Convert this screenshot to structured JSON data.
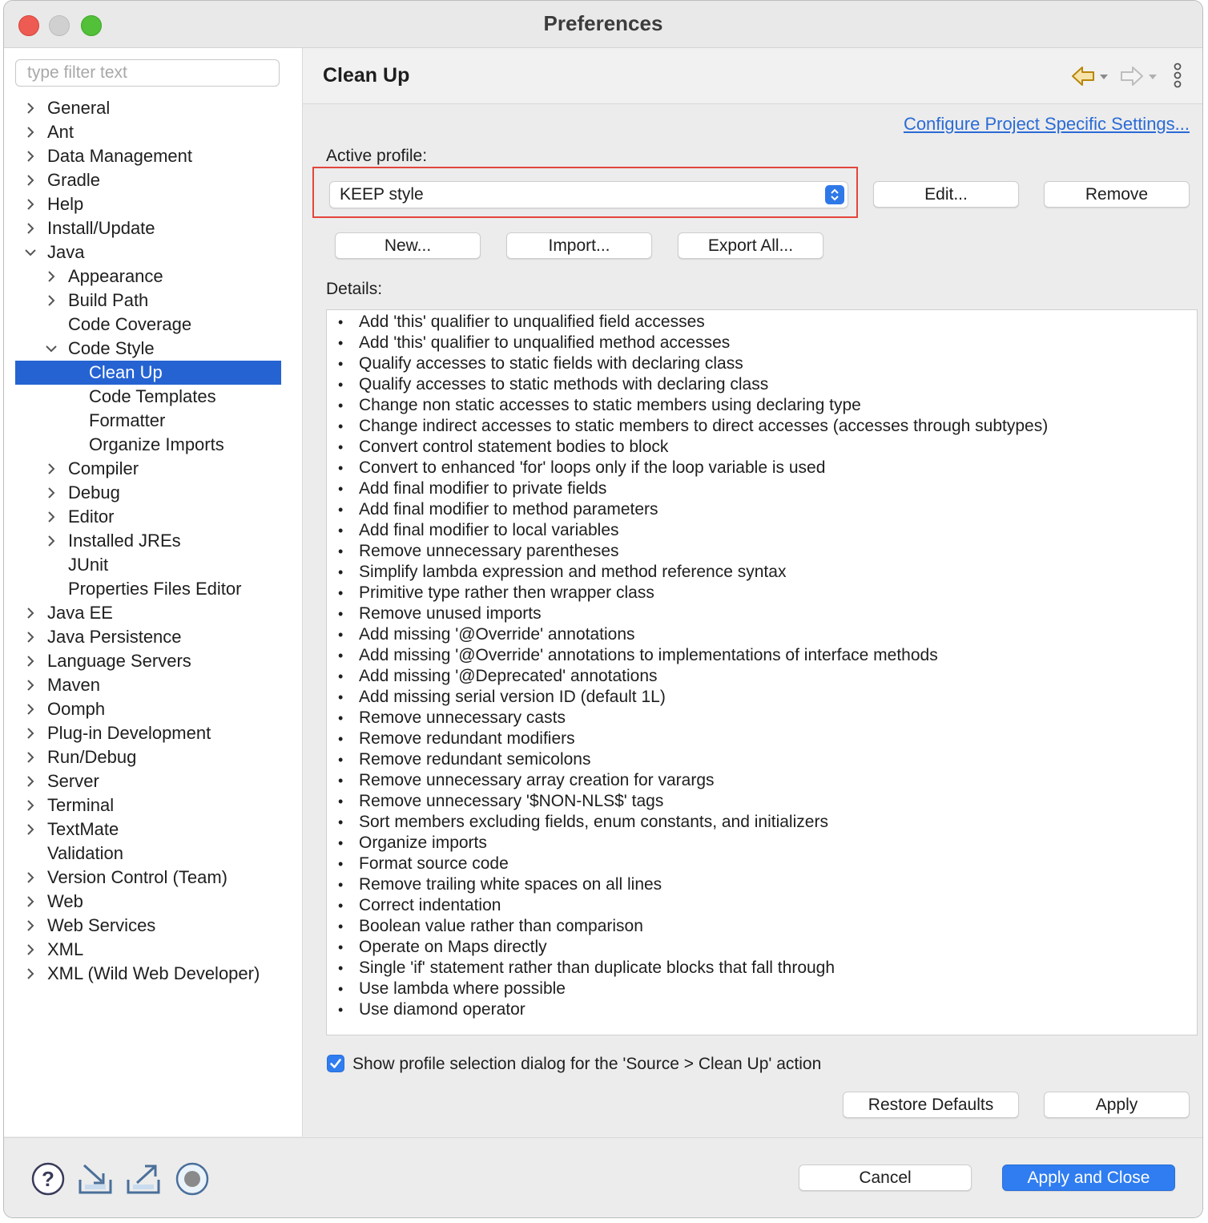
{
  "window": {
    "title": "Preferences"
  },
  "sidebar": {
    "filter_placeholder": "type filter text",
    "items": [
      {
        "label": "General",
        "level": 0,
        "expander": "collapsed"
      },
      {
        "label": "Ant",
        "level": 0,
        "expander": "collapsed"
      },
      {
        "label": "Data Management",
        "level": 0,
        "expander": "collapsed"
      },
      {
        "label": "Gradle",
        "level": 0,
        "expander": "collapsed"
      },
      {
        "label": "Help",
        "level": 0,
        "expander": "collapsed"
      },
      {
        "label": "Install/Update",
        "level": 0,
        "expander": "collapsed"
      },
      {
        "label": "Java",
        "level": 0,
        "expander": "expanded"
      },
      {
        "label": "Appearance",
        "level": 1,
        "expander": "collapsed"
      },
      {
        "label": "Build Path",
        "level": 1,
        "expander": "collapsed"
      },
      {
        "label": "Code Coverage",
        "level": 1,
        "expander": "none"
      },
      {
        "label": "Code Style",
        "level": 1,
        "expander": "expanded"
      },
      {
        "label": "Clean Up",
        "level": 2,
        "expander": "none",
        "selected": true
      },
      {
        "label": "Code Templates",
        "level": 2,
        "expander": "none"
      },
      {
        "label": "Formatter",
        "level": 2,
        "expander": "none"
      },
      {
        "label": "Organize Imports",
        "level": 2,
        "expander": "none"
      },
      {
        "label": "Compiler",
        "level": 1,
        "expander": "collapsed"
      },
      {
        "label": "Debug",
        "level": 1,
        "expander": "collapsed"
      },
      {
        "label": "Editor",
        "level": 1,
        "expander": "collapsed"
      },
      {
        "label": "Installed JREs",
        "level": 1,
        "expander": "collapsed"
      },
      {
        "label": "JUnit",
        "level": 1,
        "expander": "none"
      },
      {
        "label": "Properties Files Editor",
        "level": 1,
        "expander": "none"
      },
      {
        "label": "Java EE",
        "level": 0,
        "expander": "collapsed"
      },
      {
        "label": "Java Persistence",
        "level": 0,
        "expander": "collapsed"
      },
      {
        "label": "Language Servers",
        "level": 0,
        "expander": "collapsed"
      },
      {
        "label": "Maven",
        "level": 0,
        "expander": "collapsed"
      },
      {
        "label": "Oomph",
        "level": 0,
        "expander": "collapsed"
      },
      {
        "label": "Plug-in Development",
        "level": 0,
        "expander": "collapsed"
      },
      {
        "label": "Run/Debug",
        "level": 0,
        "expander": "collapsed"
      },
      {
        "label": "Server",
        "level": 0,
        "expander": "collapsed"
      },
      {
        "label": "Terminal",
        "level": 0,
        "expander": "collapsed"
      },
      {
        "label": "TextMate",
        "level": 0,
        "expander": "collapsed"
      },
      {
        "label": "Validation",
        "level": 0,
        "expander": "none"
      },
      {
        "label": "Version Control (Team)",
        "level": 0,
        "expander": "collapsed"
      },
      {
        "label": "Web",
        "level": 0,
        "expander": "collapsed"
      },
      {
        "label": "Web Services",
        "level": 0,
        "expander": "collapsed"
      },
      {
        "label": "XML",
        "level": 0,
        "expander": "collapsed"
      },
      {
        "label": "XML (Wild Web Developer)",
        "level": 0,
        "expander": "collapsed"
      }
    ]
  },
  "page": {
    "title": "Clean Up",
    "configure_link": "Configure Project Specific Settings...",
    "active_profile_label": "Active profile:",
    "profile_value": "KEEP style",
    "edit_label": "Edit...",
    "remove_label": "Remove",
    "new_label": "New...",
    "import_label": "Import...",
    "export_label": "Export All...",
    "details_label": "Details:",
    "details": [
      "Add 'this' qualifier to unqualified field accesses",
      "Add 'this' qualifier to unqualified method accesses",
      "Qualify accesses to static fields with declaring class",
      "Qualify accesses to static methods with declaring class",
      "Change non static accesses to static members using declaring type",
      "Change indirect accesses to static members to direct accesses (accesses through subtypes)",
      "Convert control statement bodies to block",
      "Convert to enhanced 'for' loops only if the loop variable is used",
      "Add final modifier to private fields",
      "Add final modifier to method parameters",
      "Add final modifier to local variables",
      "Remove unnecessary parentheses",
      "Simplify lambda expression and method reference syntax",
      "Primitive type rather then wrapper class",
      "Remove unused imports",
      "Add missing '@Override' annotations",
      "Add missing '@Override' annotations to implementations of interface methods",
      "Add missing '@Deprecated' annotations",
      "Add missing serial version ID (default 1L)",
      "Remove unnecessary casts",
      "Remove redundant modifiers",
      "Remove redundant semicolons",
      "Remove unnecessary array creation for varargs",
      "Remove unnecessary '$NON-NLS$' tags",
      "Sort members excluding fields, enum constants, and initializers",
      "Organize imports",
      "Format source code",
      "Remove trailing white spaces on all lines",
      "Correct indentation",
      "Boolean value rather than comparison",
      "Operate on Maps directly",
      "Single 'if' statement rather than duplicate blocks that fall through",
      "Use lambda where possible",
      "Use diamond operator"
    ],
    "show_dialog_label": "Show profile selection dialog for the 'Source > Clean Up' action",
    "show_dialog_checked": true,
    "restore_defaults_label": "Restore Defaults",
    "apply_label": "Apply"
  },
  "footer": {
    "cancel_label": "Cancel",
    "apply_close_label": "Apply and Close",
    "icons": [
      "help-icon",
      "import-icon",
      "export-icon",
      "record-icon"
    ]
  },
  "colors": {
    "selection": "#2563d3",
    "accent": "#2f7df0",
    "highlight_border": "#e3463c",
    "link": "#2a6bd6"
  }
}
